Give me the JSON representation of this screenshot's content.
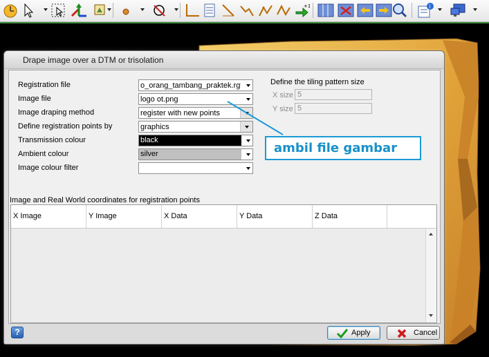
{
  "dialog": {
    "title": "Drape image over a DTM or trisolation",
    "fields": [
      {
        "label": "Registration file",
        "value": "o_orang_tambang_praktek.rgf"
      },
      {
        "label": "Image file",
        "value": "logo ot.png"
      },
      {
        "label": "Image draping method",
        "value": "register with new points"
      },
      {
        "label": "Define registration points by",
        "value": "graphics"
      },
      {
        "label": "Transmission colour",
        "value": "black"
      },
      {
        "label": "Ambient colour",
        "value": "silver"
      },
      {
        "label": "Image colour filter",
        "value": ""
      }
    ],
    "tiling": {
      "legend": "Define the tiling pattern size",
      "x_label": "X size",
      "x_value": "5",
      "y_label": "Y size",
      "y_value": "5"
    },
    "grid": {
      "label": "Image and Real World coordinates for registration points",
      "columns": [
        "X Image",
        "Y Image",
        "X Data",
        "Y Data",
        "Z Data"
      ]
    },
    "buttons": {
      "help": "?",
      "apply": "Apply",
      "cancel": "Cancel"
    }
  },
  "annotation": {
    "text": "ambil file gambar"
  },
  "colors": {
    "transmission_swatch": "#000000",
    "ambient_swatch": "#c0c0c0",
    "annotation_accent": "#1a9ad6",
    "surface": "#e7a93b"
  },
  "toolbar": {
    "icons": [
      "clock-orange-icon",
      "pointer-icon",
      "select-region-icon",
      "transform-arrows-icon",
      "image-tool-icon",
      "point-icon",
      "no-draw-icon",
      "line-design-icon",
      "page-lines-icon",
      "diagonal-line-icon",
      "polyline-icon",
      "path-icon",
      "add-point-icon",
      "columns-icon",
      "delete-columns-icon",
      "left-right-icon",
      "arrow-right-icon",
      "zoom-icon",
      "info-icon",
      "monitor-icon"
    ]
  }
}
